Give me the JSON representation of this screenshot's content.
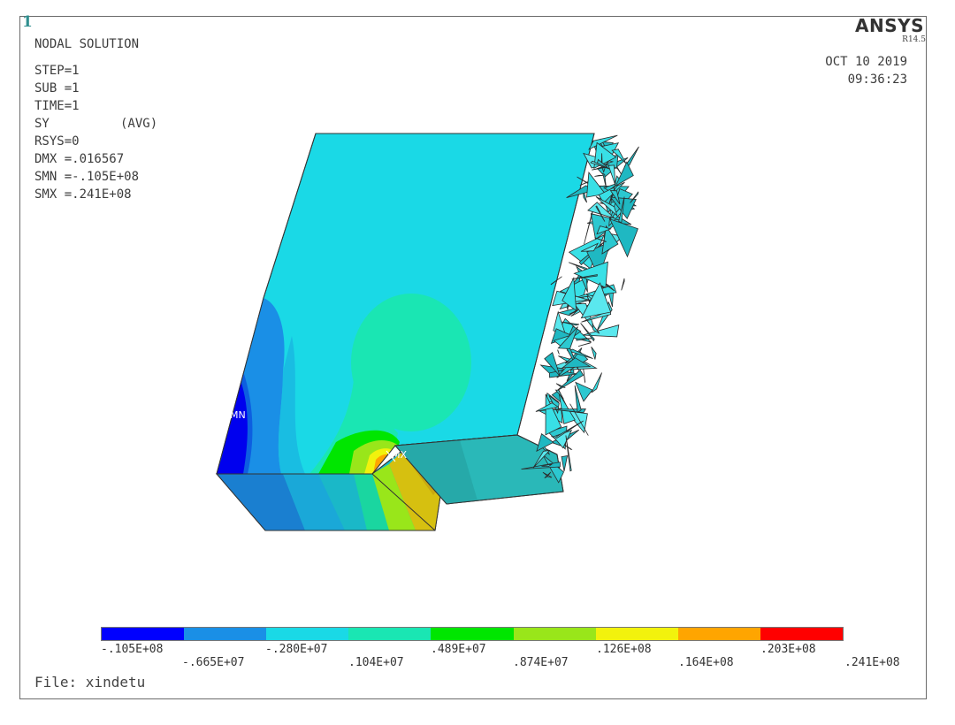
{
  "window": {
    "number": "1"
  },
  "header": {
    "title": "NODAL SOLUTION",
    "step": "STEP=1",
    "sub": "SUB =1",
    "time": "TIME=1",
    "component": "SY",
    "avg": "(AVG)",
    "rsys": "RSYS=0",
    "dmx": "DMX =.016567",
    "smn": "SMN =-.105E+08",
    "smx": "SMX =.241E+08"
  },
  "brand": {
    "name": "ANSYS",
    "version": "R14.5"
  },
  "timestamp": {
    "date": "OCT 10 2019",
    "time": "09:36:23"
  },
  "markers": {
    "min": "MN",
    "max": "MX"
  },
  "legend": {
    "colors": [
      "#0000ff",
      "#1a8fe6",
      "#1ad9e6",
      "#1ae6b3",
      "#00e600",
      "#99e61a",
      "#f2f20d",
      "#ffa500",
      "#ff0000"
    ],
    "ticks_top": [
      "-.105E+08",
      "-.280E+07",
      ".489E+07",
      ".126E+08",
      ".203E+08"
    ],
    "ticks_bottom": [
      "-.665E+07",
      ".104E+07",
      ".874E+07",
      ".164E+08",
      ".241E+08"
    ]
  },
  "file": {
    "label": "File: xindetu"
  }
}
